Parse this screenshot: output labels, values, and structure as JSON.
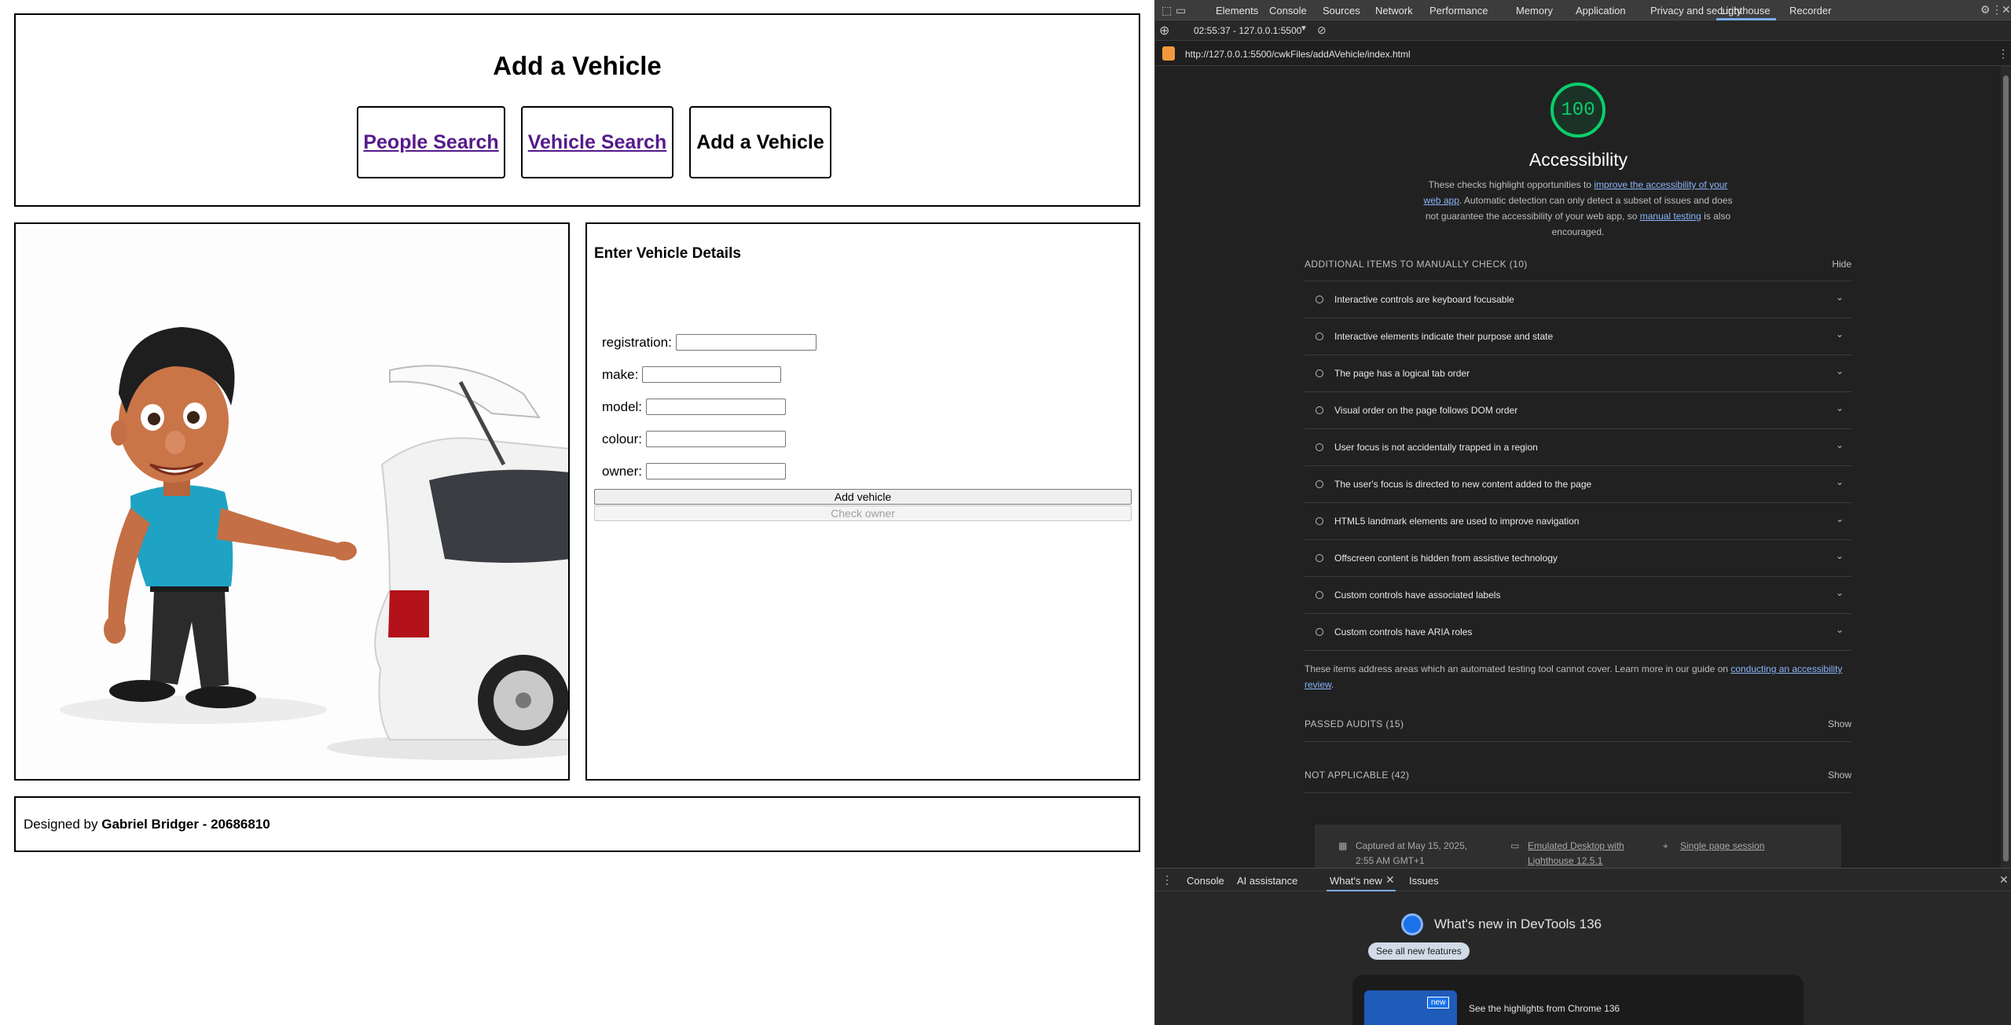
{
  "page": {
    "title": "Add a Vehicle",
    "nav": [
      {
        "label": "People Search"
      },
      {
        "label": "Vehicle Search"
      },
      {
        "label": "Add a Vehicle"
      }
    ],
    "form": {
      "heading": "Enter Vehicle Details",
      "fields": [
        {
          "label": "registration:",
          "value": ""
        },
        {
          "label": "make:",
          "value": ""
        },
        {
          "label": "model:",
          "value": ""
        },
        {
          "label": "colour:",
          "value": ""
        },
        {
          "label": "owner:",
          "value": ""
        }
      ],
      "add_button": "Add vehicle",
      "check_button": "Check owner"
    },
    "footer": {
      "prefix": "Designed by ",
      "author": "Gabriel Bridger - 20686810"
    }
  },
  "devtools": {
    "tabs": [
      "Elements",
      "Console",
      "Sources",
      "Network",
      "Performance",
      "Memory",
      "Application",
      "Privacy and security",
      "Lighthouse",
      "Recorder"
    ],
    "active_tab": "Lighthouse",
    "session": "02:55:37 - 127.0.0.1:5500",
    "url": "http://127.0.0.1:5500/cwkFiles/addAVehicle/index.html",
    "lighthouse": {
      "score": "100",
      "category": "Accessibility",
      "desc_1": "These checks highlight opportunities to ",
      "desc_link_1": "improve the accessibility of your web app",
      "desc_2": ". Automatic detection can only detect a subset of issues and does not guarantee the accessibility of your web app, so ",
      "desc_link_2": "manual testing",
      "desc_3": " is also encouraged.",
      "manual_header": "ADDITIONAL ITEMS TO MANUALLY CHECK (10)",
      "manual_toggle": "Hide",
      "manual_items": [
        "Interactive controls are keyboard focusable",
        "Interactive elements indicate their purpose and state",
        "The page has a logical tab order",
        "Visual order on the page follows DOM order",
        "User focus is not accidentally trapped in a region",
        "The user's focus is directed to new content added to the page",
        "HTML5 landmark elements are used to improve navigation",
        "Offscreen content is hidden from assistive technology",
        "Custom controls have associated labels",
        "Custom controls have ARIA roles"
      ],
      "manual_footer_text": "These items address areas which an automated testing tool cannot cover. Learn more in our guide on ",
      "manual_footer_link": "conducting an accessibility review",
      "manual_footer_end": ".",
      "passed_header": "PASSED AUDITS (15)",
      "passed_toggle": "Show",
      "na_header": "NOT APPLICABLE (42)",
      "na_toggle": "Show",
      "captured_1": "Captured at May 15, 2025,",
      "captured_2": "2:55 AM GMT+1",
      "emulated_1": "Emulated Desktop with",
      "emulated_2": "Lighthouse 12.5.1",
      "session_type": "Single page session"
    },
    "drawer_tabs": [
      "Console",
      "AI assistance",
      "What's new",
      "Issues"
    ],
    "whats_new": {
      "title": "What's new in DevTools 136",
      "button": "See all new features",
      "badge": "new",
      "card_text": "See the highlights from Chrome 136"
    },
    "colors": {
      "score_green": "#0cce6b",
      "link_blue": "#8ab4f8",
      "visited_link": "#551a8b"
    }
  }
}
